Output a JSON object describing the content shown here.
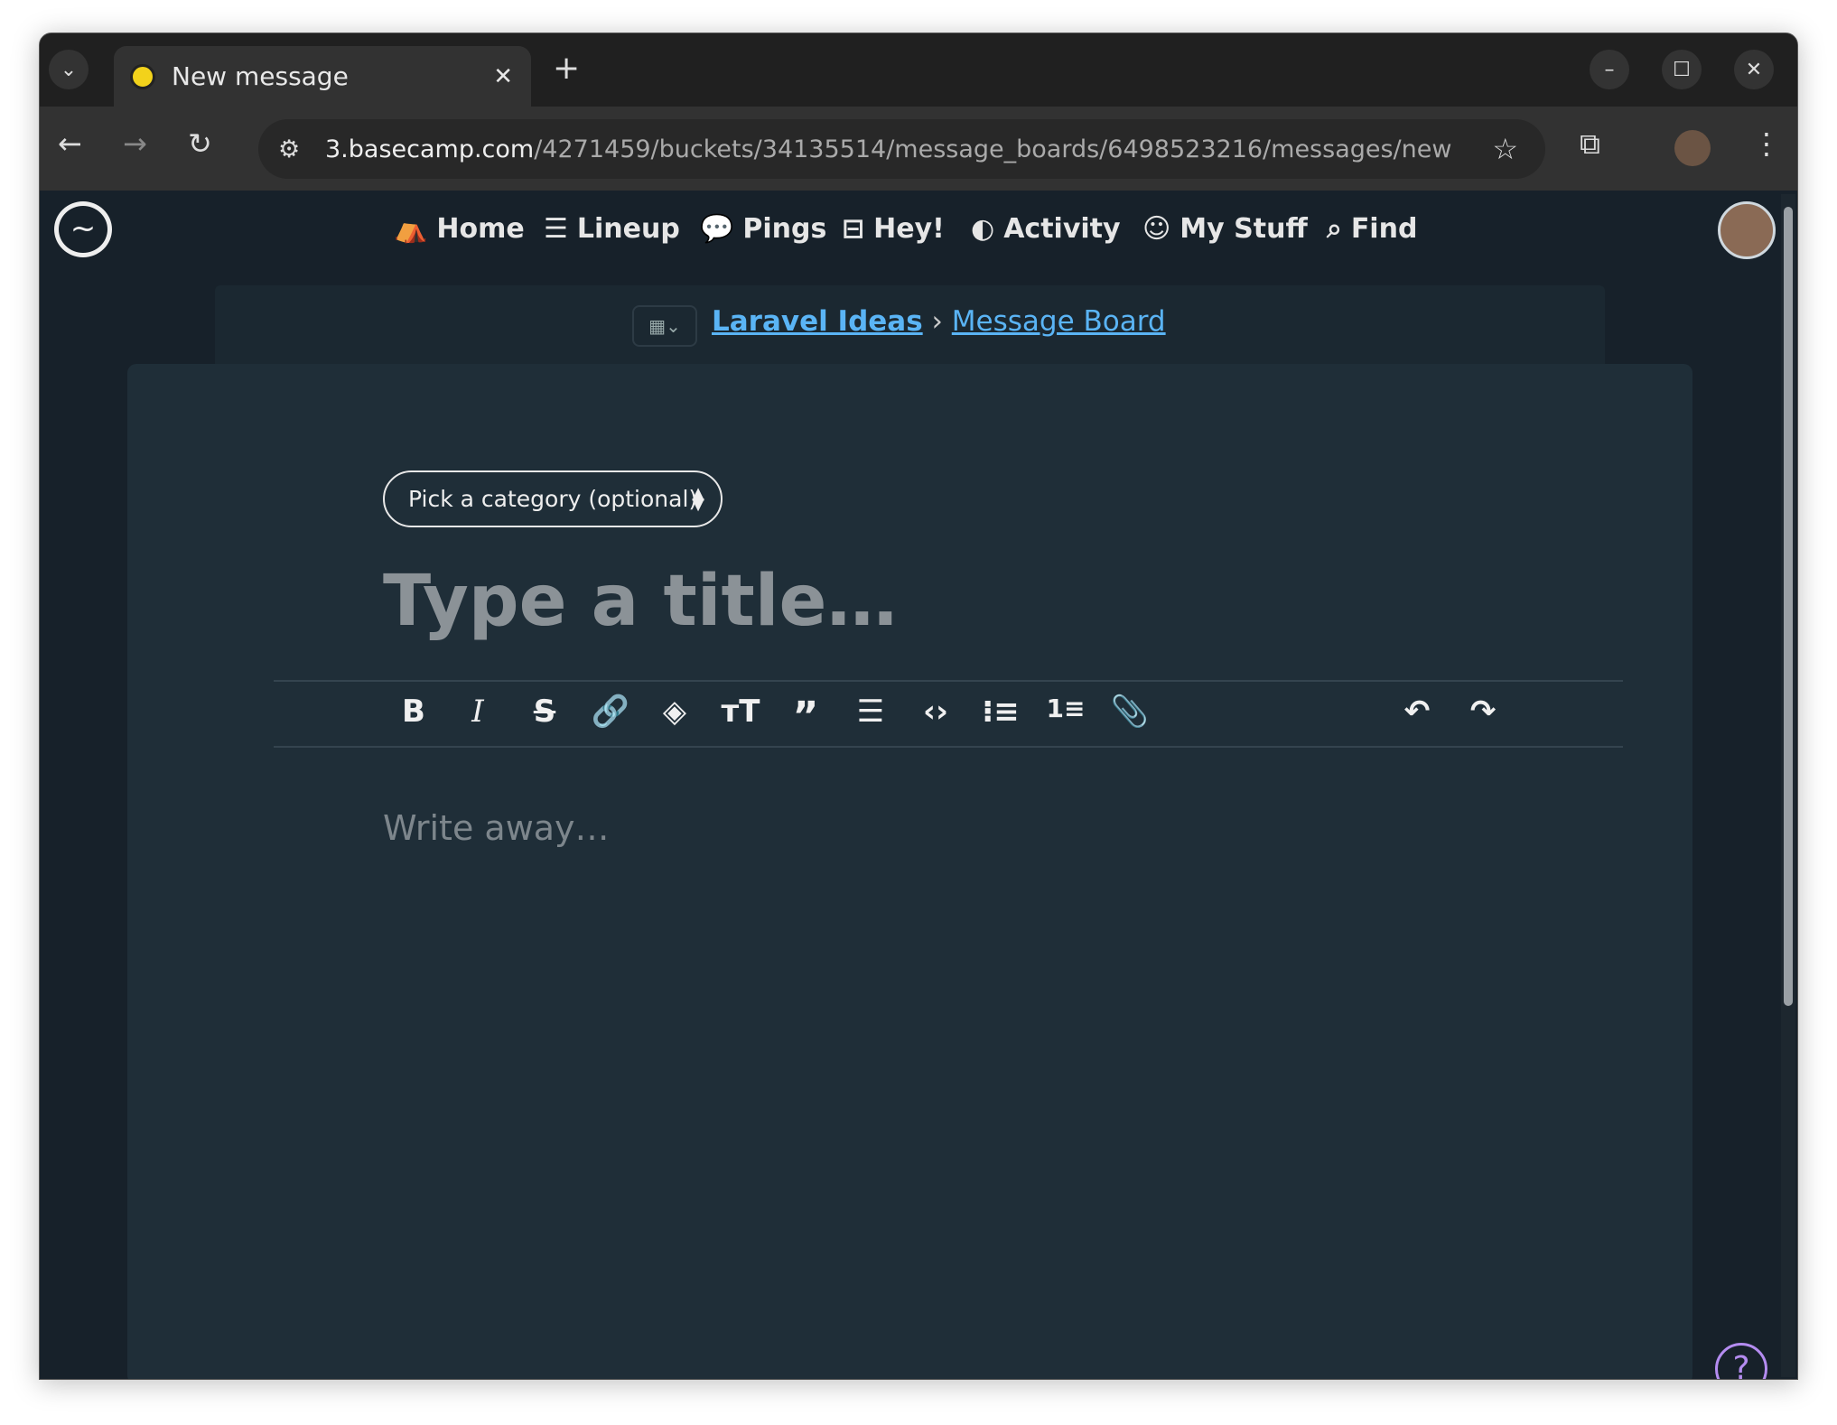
{
  "browser": {
    "tab_title": "New message",
    "url_host": "3.basecamp.com",
    "url_path": "/4271459/buckets/34135514/message_boards/6498523216/messages/new"
  },
  "nav": {
    "items": [
      {
        "label": "Home",
        "icon": "home-icon"
      },
      {
        "label": "Lineup",
        "icon": "lineup-icon"
      },
      {
        "label": "Pings",
        "icon": "pings-icon"
      },
      {
        "label": "Hey!",
        "icon": "inbox-icon"
      },
      {
        "label": "Activity",
        "icon": "activity-icon"
      },
      {
        "label": "My Stuff",
        "icon": "smile-icon"
      },
      {
        "label": "Find",
        "icon": "search-icon"
      }
    ]
  },
  "breadcrumb": {
    "project": "Laravel Ideas",
    "separator": "›",
    "board": "Message Board"
  },
  "form": {
    "category_placeholder": "Pick a category (optional)",
    "title_placeholder": "Type a title…",
    "body_placeholder": "Write away…"
  },
  "toolbar": [
    "bold",
    "italic",
    "strikethrough",
    "link",
    "highlight",
    "heading",
    "quote",
    "divider",
    "code",
    "bullet-list",
    "numbered-list",
    "attach",
    "undo",
    "redo"
  ],
  "colors": {
    "page_bg": "#17212a",
    "card_bg": "#1f2e38",
    "link": "#5ab4f5",
    "help": "#b48cf0"
  }
}
